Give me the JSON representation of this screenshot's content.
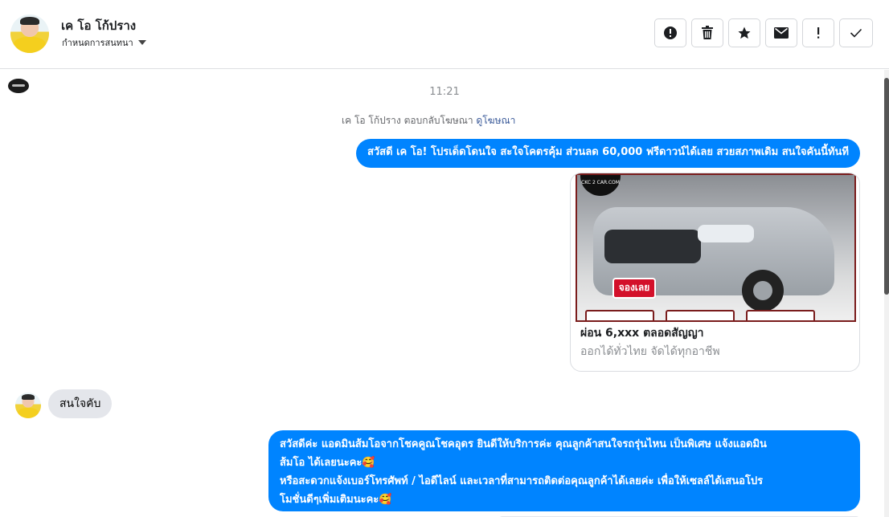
{
  "header": {
    "title": "เค โอ โก้ปราง",
    "subtitle": "กำหนดการสนทนา",
    "toolbar": [
      {
        "name": "report-button",
        "icon": "alert-circle-icon"
      },
      {
        "name": "delete-button",
        "icon": "trash-icon"
      },
      {
        "name": "star-button",
        "icon": "star-icon"
      },
      {
        "name": "mark-unread-button",
        "icon": "envelope-icon"
      },
      {
        "name": "important-button",
        "icon": "exclamation-icon"
      },
      {
        "name": "done-button",
        "icon": "check-icon"
      }
    ]
  },
  "conversation": {
    "time": "11:21",
    "meta_text": "เค โอ โก้ปราง ตอบกลับโฆษณา",
    "meta_link": "ดูโฆษณา",
    "out_message_1": "สวัสดี เค โอ! โปรเด็ดโดนใจ สะใจโคตรคุ้ม ส่วนลด 60,000 ฟรีดาวน์ได้เลย สวยสภาพเดิม สนใจคันนี้ทันที",
    "ad": {
      "badge": "CKC 2 CAR.COM",
      "sticker": "จองเลย",
      "title": "ผ่อน 6,xxx ตลอดสัญญา",
      "description": "ออกได้ทั่วไทย จัดได้ทุกอาชีพ"
    },
    "in_message_1": "สนใจคับ",
    "out_message_2": {
      "line1": "สวัสดีค่ะ แอดมินส้มโอจากโชคคูณโชคอุดร ยินดีให้บริการค่ะ   คุณลูกค้าสนใจรถรุ่นไหน เป็นพิเศษ แจ้งแอดมิน",
      "line2": "ส้มโอ ได้เลยนะคะ🥰",
      "line3": "หรือสะดวกแจ้งเบอร์โทรศัพท์ / ไอดีไลน์ และเวลาที่สามารถติดต่อคุณลูกค้าได้เลยค่ะ เพื่อให้เซลล์ได้เสนอโปร",
      "line4": "โมชั่นดีๆเพิ่มเติมนะคะ🥰"
    }
  },
  "colors": {
    "accent": "#0084ff",
    "incoming_bubble": "#e4e6eb",
    "link": "#385898"
  }
}
